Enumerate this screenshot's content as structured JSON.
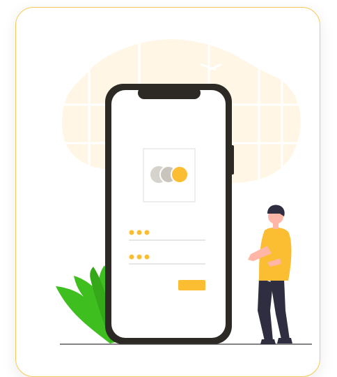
{
  "card": {
    "border_color": "#f7c95a",
    "background": "#ffffff"
  },
  "illustration": {
    "blob_color": "#fff6e6",
    "phone_frame_color": "#2d2a26",
    "accent_color": "#fbbd32",
    "leaf_color": "#3fbf1f",
    "card_chip_colors": [
      "#d6d2cc",
      "#c9c5bd",
      "#fbbd32"
    ],
    "icons": [
      "payment-card-icon",
      "password-dots-icon",
      "submit-button",
      "person-figure",
      "plant-leaves"
    ]
  },
  "form": {
    "field_count": 2,
    "dots_per_field": 3
  }
}
